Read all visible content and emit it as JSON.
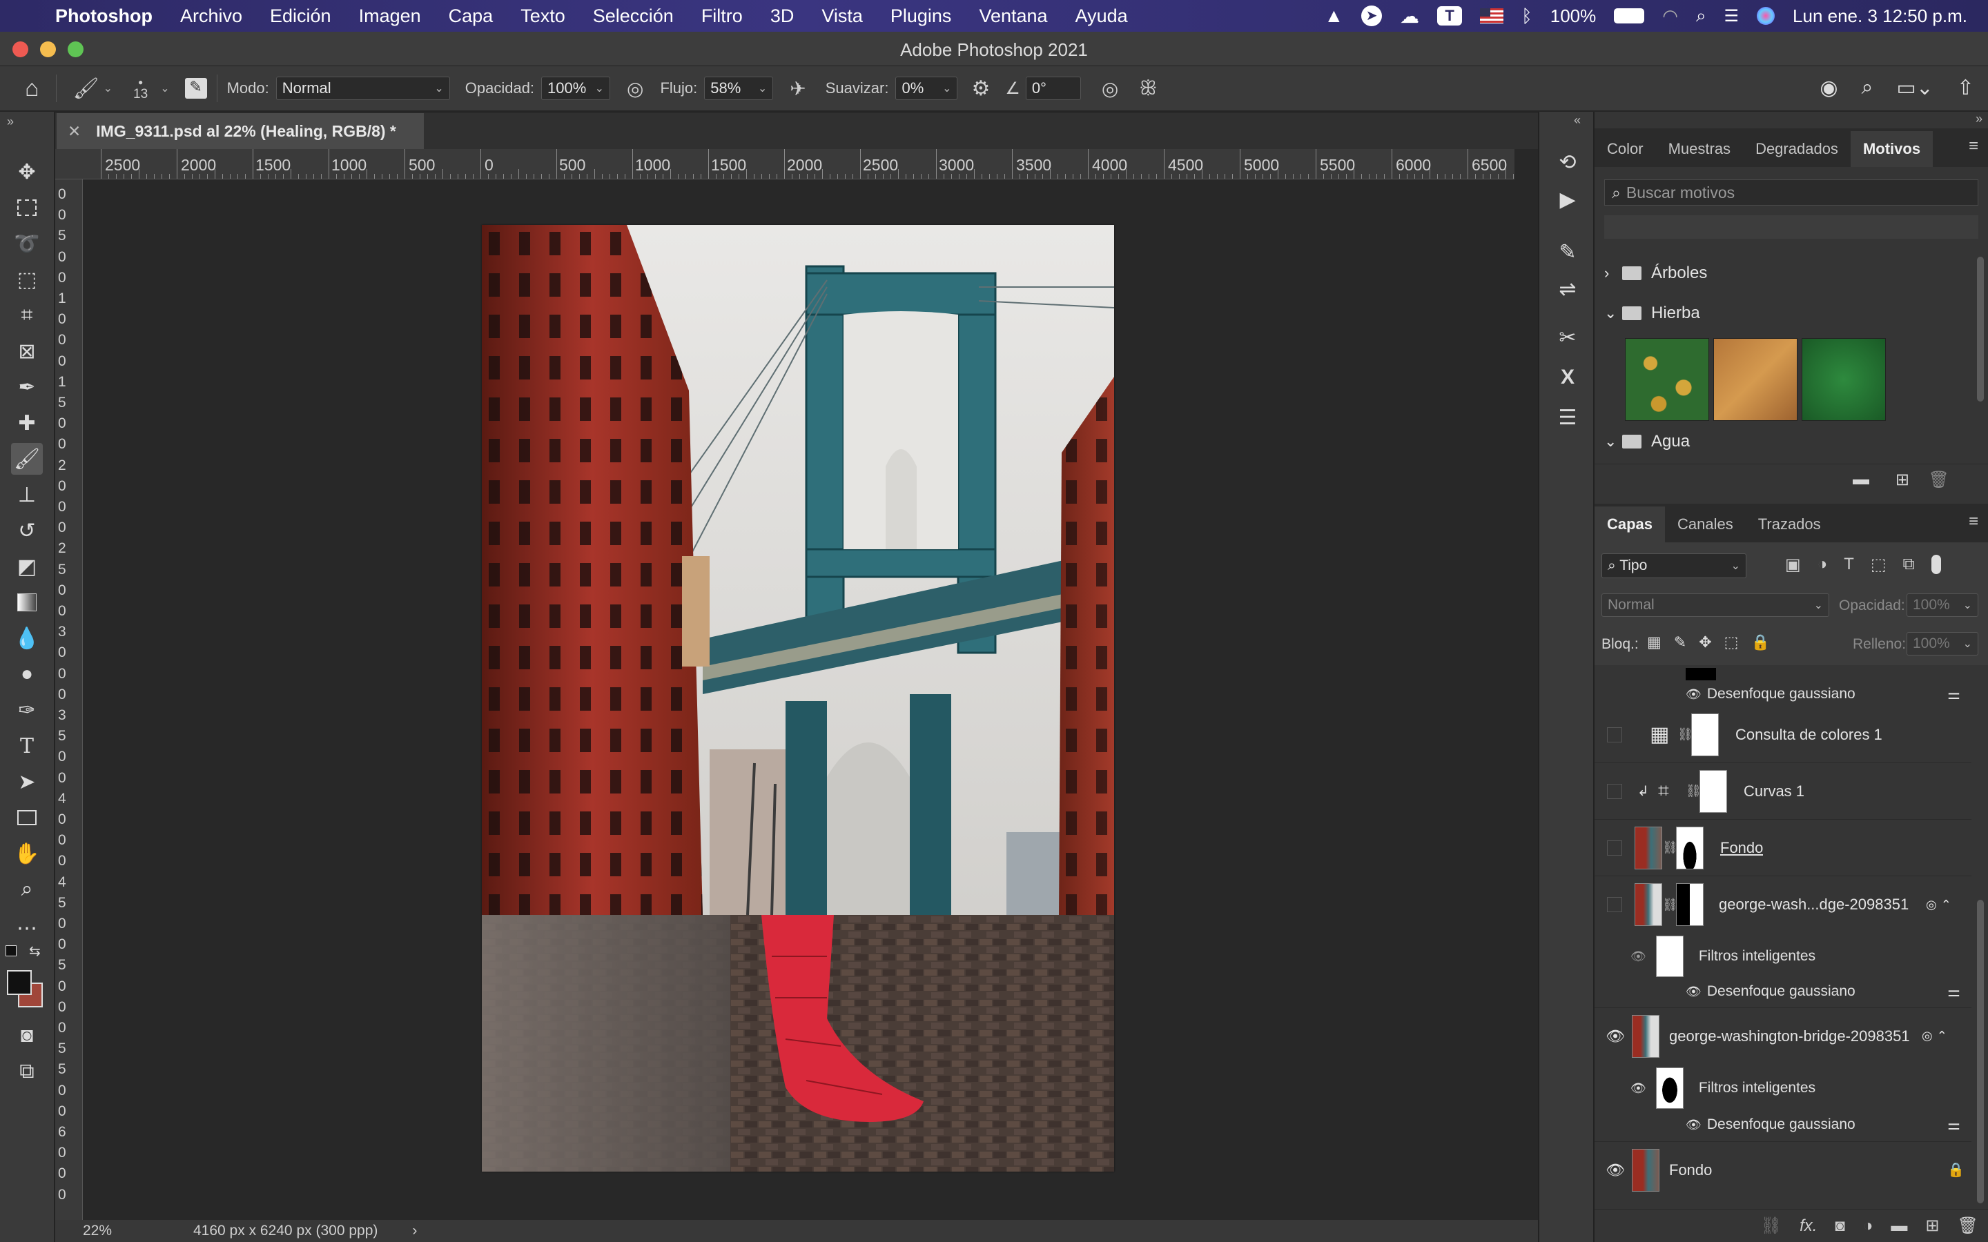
{
  "menubar": {
    "apple": "",
    "app": "Photoshop",
    "items": [
      "Archivo",
      "Edición",
      "Imagen",
      "Capa",
      "Texto",
      "Selección",
      "Filtro",
      "3D",
      "Vista",
      "Plugins",
      "Ventana",
      "Ayuda"
    ],
    "battery": "100%",
    "datetime": "Lun ene. 3  12:50 p.m."
  },
  "window": {
    "title": "Adobe Photoshop 2021"
  },
  "options": {
    "brush_size": "13",
    "mode_label": "Modo:",
    "mode_value": "Normal",
    "opacity_label": "Opacidad:",
    "opacity_value": "100%",
    "flow_label": "Flujo:",
    "flow_value": "58%",
    "smoothing_label": "Suavizar:",
    "smoothing_value": "0%",
    "angle_value": "0°"
  },
  "document": {
    "tab_title": "IMG_9311.psd al 22% (Healing, RGB/8) *",
    "zoom": "22%",
    "dimensions": "4160 px x 6240 px (300 ppp)"
  },
  "rulers": {
    "h_labels": [
      "2500",
      "2000",
      "1500",
      "1000",
      "500",
      "0",
      "500",
      "1000",
      "1500",
      "2000",
      "2500",
      "3000",
      "3500",
      "4000",
      "4500",
      "5000",
      "5500",
      "6000",
      "6500"
    ],
    "v_labels": [
      "0",
      "0",
      "5",
      "0",
      "0",
      "1",
      "0",
      "0",
      "0",
      "1",
      "5",
      "0",
      "0",
      "2",
      "0",
      "0",
      "0",
      "2",
      "5",
      "0",
      "0",
      "3",
      "0",
      "0",
      "0",
      "3",
      "5",
      "0",
      "0",
      "4",
      "0",
      "0",
      "0",
      "4",
      "5",
      "0",
      "0",
      "5",
      "0",
      "0",
      "0",
      "5",
      "5",
      "0",
      "0",
      "6",
      "0",
      "0",
      "0"
    ]
  },
  "patterns_panel": {
    "tabs": [
      "Color",
      "Muestras",
      "Degradados",
      "Motivos"
    ],
    "active_tab": "Motivos",
    "search_placeholder": "Buscar motivos",
    "groups": [
      "Árboles",
      "Hierba",
      "Agua"
    ]
  },
  "layers_panel": {
    "tabs": [
      "Capas",
      "Canales",
      "Trazados"
    ],
    "active_tab": "Capas",
    "filter_label": "Tipo",
    "blend_mode": "Normal",
    "opacity_label": "Opacidad:",
    "opacity_value": "100%",
    "lock_label": "Bloq.:",
    "fill_label": "Relleno:",
    "fill_value": "100%",
    "rows": {
      "blur_top": "Desenfoque gaussiano",
      "lut": "Consulta de colores 1",
      "curves": "Curvas 1",
      "fondo_group": "Fondo",
      "gw_short": "george-wash...dge-2098351",
      "smart1": "Filtros inteligentes",
      "blur1": "Desenfoque gaussiano",
      "gw_full": "george-washington-bridge-2098351",
      "smart2": "Filtros inteligentes",
      "blur2": "Desenfoque gaussiano",
      "background": "Fondo"
    },
    "footer_fx": "fx."
  }
}
